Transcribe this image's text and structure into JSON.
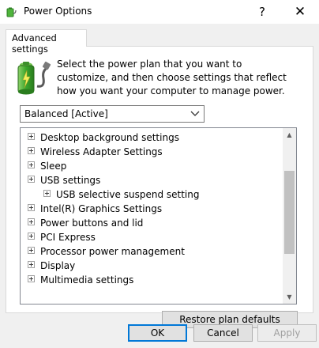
{
  "window": {
    "title": "Power Options",
    "help_glyph": "?",
    "close_glyph": "✕"
  },
  "tab": {
    "label": "Advanced settings"
  },
  "description": "Select the power plan that you want to customize, and then choose settings that reflect how you want your computer to manage power.",
  "plan_select": {
    "value": "Balanced [Active]"
  },
  "tree": {
    "items": [
      {
        "label": "Desktop background settings",
        "level": 0
      },
      {
        "label": "Wireless Adapter Settings",
        "level": 0
      },
      {
        "label": "Sleep",
        "level": 0
      },
      {
        "label": "USB settings",
        "level": 0
      },
      {
        "label": "USB selective suspend setting",
        "level": 1
      },
      {
        "label": "Intel(R) Graphics Settings",
        "level": 0
      },
      {
        "label": "Power buttons and lid",
        "level": 0
      },
      {
        "label": "PCI Express",
        "level": 0
      },
      {
        "label": "Processor power management",
        "level": 0
      },
      {
        "label": "Display",
        "level": 0
      },
      {
        "label": "Multimedia settings",
        "level": 0
      }
    ]
  },
  "buttons": {
    "restore": "Restore plan defaults",
    "ok": "OK",
    "cancel": "Cancel",
    "apply": "Apply"
  },
  "colors": {
    "focus_border": "#0078d7",
    "battery_green": "#4fb43c",
    "plug_gray": "#5a5a5a"
  }
}
